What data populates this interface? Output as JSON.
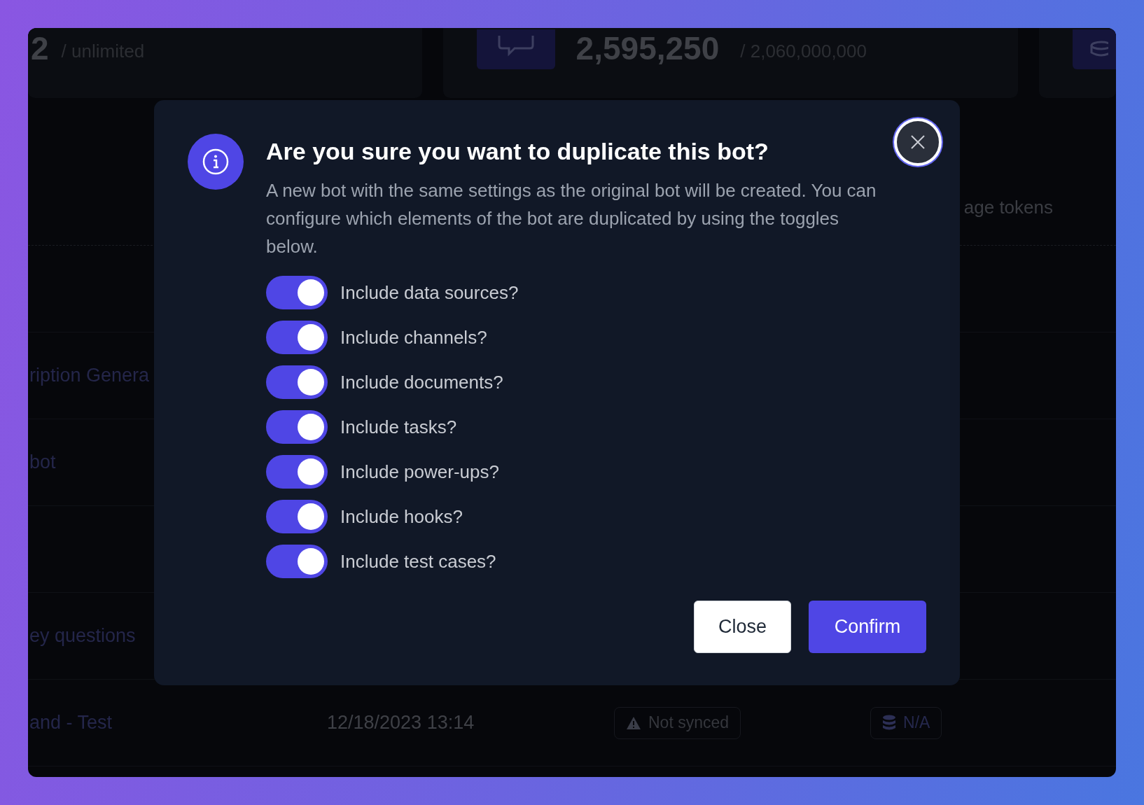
{
  "background": {
    "stats": [
      {
        "value": "2",
        "limit": "/ unlimited"
      },
      {
        "value": "2,595,250",
        "limit": "/ 2,060,000,000"
      }
    ],
    "table": {
      "column_header": "age tokens",
      "rows": [
        {},
        {
          "name": "ription Genera"
        },
        {
          "name": "bot"
        },
        {},
        {
          "name": "ey questions"
        },
        {
          "name": "and - Test",
          "date": "12/18/2023 13:14",
          "sync_status": "Not synced",
          "storage": "N/A"
        }
      ]
    }
  },
  "dialog": {
    "title": "Are you sure you want to duplicate this bot?",
    "description": "A new bot with the same settings as the original bot will be created. You can configure which elements of the bot are duplicated by using the toggles below.",
    "options": [
      {
        "label": "Include data sources?",
        "on": true
      },
      {
        "label": "Include channels?",
        "on": true
      },
      {
        "label": "Include documents?",
        "on": true
      },
      {
        "label": "Include tasks?",
        "on": true
      },
      {
        "label": "Include power-ups?",
        "on": true
      },
      {
        "label": "Include hooks?",
        "on": true
      },
      {
        "label": "Include test cases?",
        "on": true
      }
    ],
    "buttons": [
      {
        "label": "Close",
        "kind": "secondary"
      },
      {
        "label": "Confirm",
        "kind": "primary"
      }
    ]
  }
}
